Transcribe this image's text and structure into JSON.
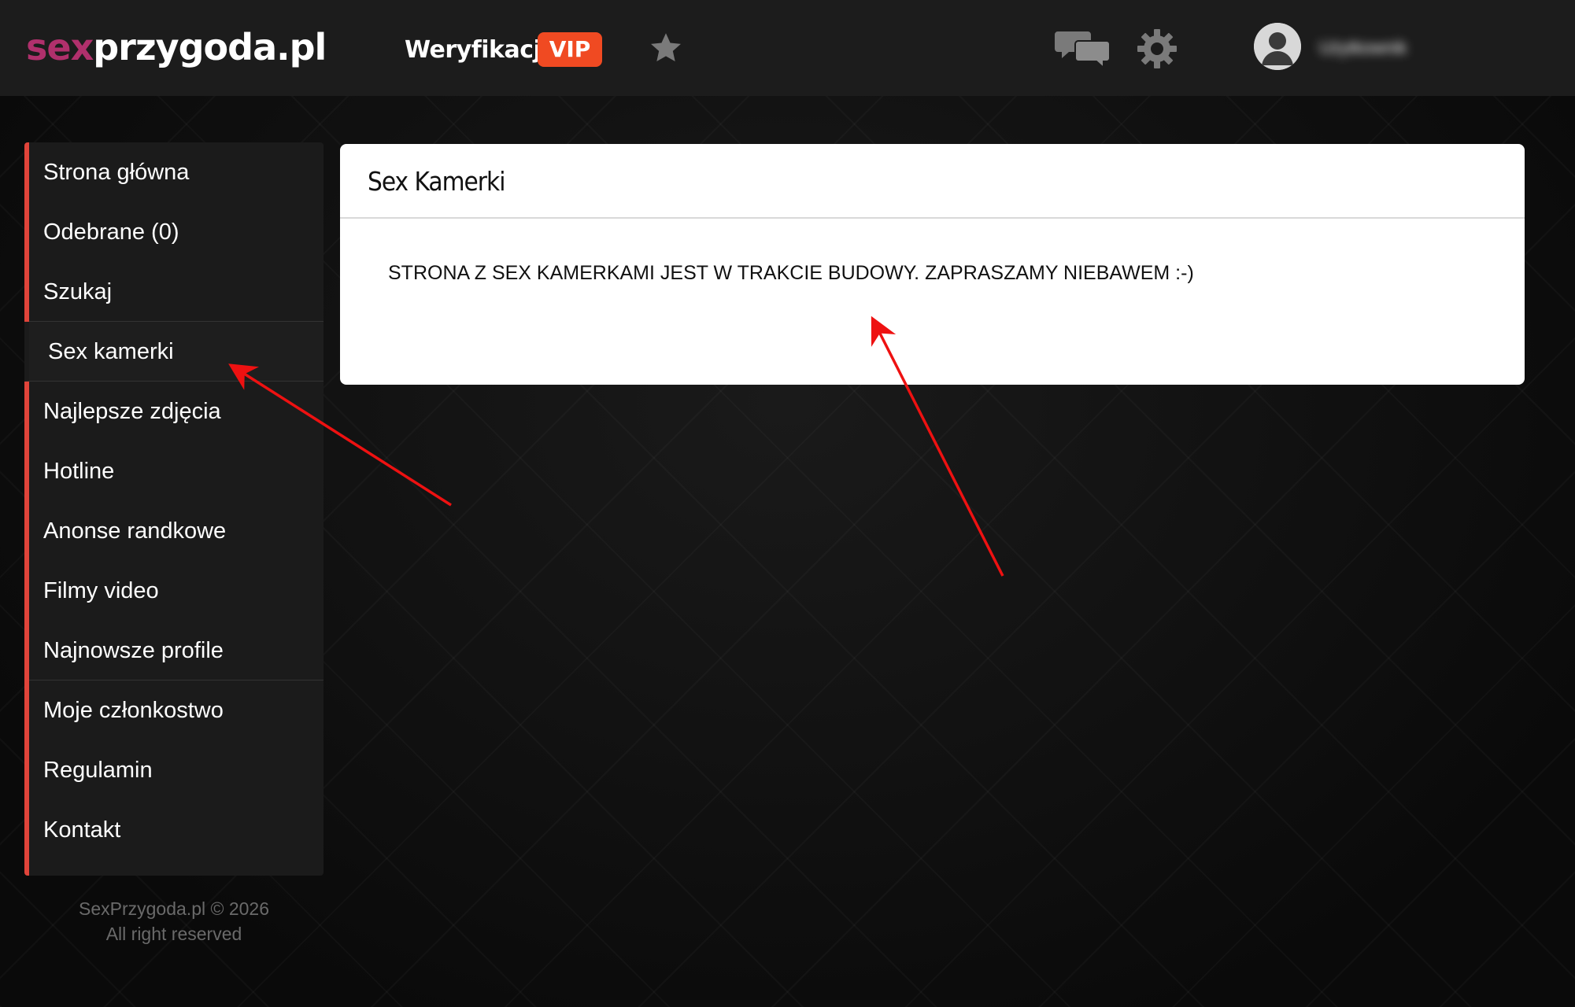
{
  "header": {
    "logo_prefix": "sex",
    "logo_suffix": "przygoda.pl",
    "verify_label": "Weryfikacja",
    "vip_badge": "VIP",
    "icons": [
      "star-icon",
      "chat-icon",
      "gear-icon",
      "user-avatar-icon"
    ],
    "username": "Użytkownik"
  },
  "sidebar": {
    "items": [
      {
        "label": "Strona główna"
      },
      {
        "label": "Odebrane (0)"
      },
      {
        "label": "Szukaj"
      },
      {
        "label": "Sex kamerki",
        "active": true
      },
      {
        "label": "Najlepsze zdjęcia"
      },
      {
        "label": "Hotline"
      },
      {
        "label": "Anonse randkowe"
      },
      {
        "label": "Filmy video"
      },
      {
        "label": "Najnowsze profile"
      },
      {
        "label": "Moje członkostwo"
      },
      {
        "label": "Regulamin"
      },
      {
        "label": "Kontakt"
      }
    ]
  },
  "footer": {
    "line1": "SexPrzygoda.pl © 2026",
    "line2": "All right reserved"
  },
  "main": {
    "title": "Sex Kamerki",
    "message": "STRONA Z SEX KAMERKAMI JEST W TRAKCIE BUDOWY. ZAPRASZAMY NIEBAWEM :-)"
  },
  "colors": {
    "accent": "#e0443a",
    "vip": "#f04a22",
    "logo_accent": "#b0306c",
    "annotation": "#ee1111"
  }
}
